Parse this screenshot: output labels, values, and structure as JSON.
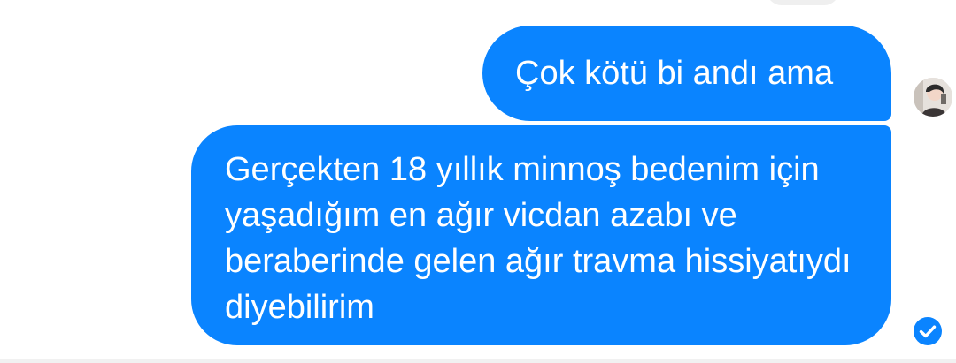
{
  "conversation": {
    "messages": [
      {
        "text": "Çok kötü bi andı ama",
        "direction": "outgoing"
      },
      {
        "text": "Gerçekten 18 yıllık minnoş bedenim için yaşadığım en ağır vicdan azabı ve beraberinde gelen ağır travma hissiyatıydı diyebilirim",
        "direction": "outgoing"
      }
    ],
    "avatar_icon": "user-avatar-icon",
    "status_icon": "read-check-icon",
    "colors": {
      "outgoing_bubble": "#0a84ff",
      "outgoing_text": "#ffffff",
      "background": "#ffffff",
      "status": "#0a84ff"
    }
  }
}
